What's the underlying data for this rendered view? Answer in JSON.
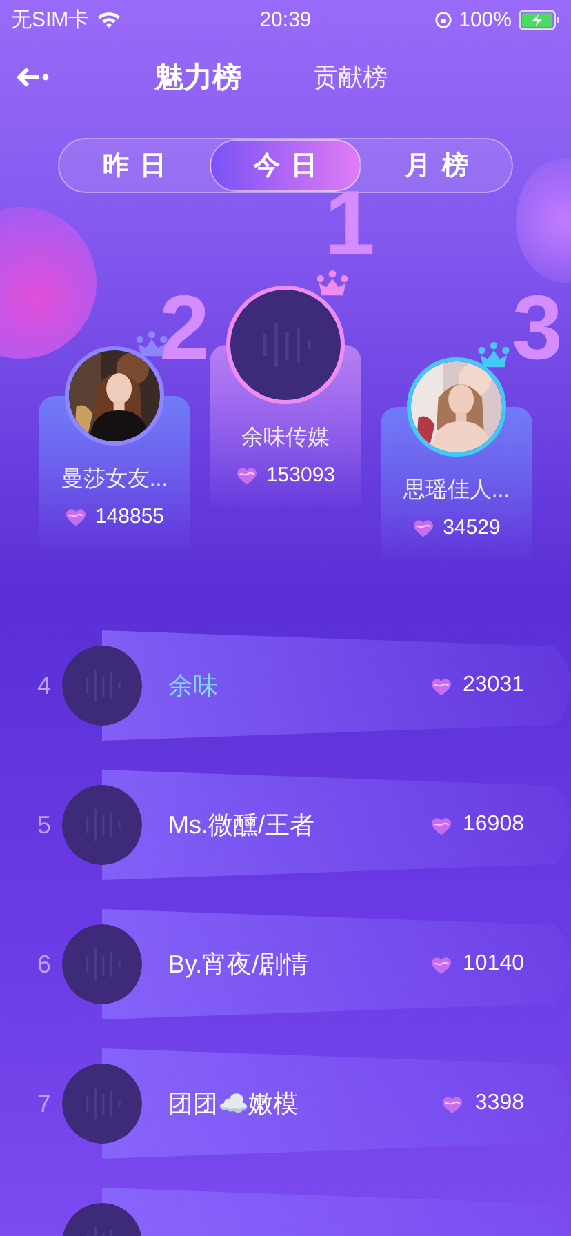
{
  "status_bar": {
    "carrier": "无SIM卡",
    "time": "20:39",
    "battery": "100%"
  },
  "nav_tabs": [
    {
      "label": "魅力榜",
      "selected": true
    },
    {
      "label": "贡献榜",
      "selected": false
    }
  ],
  "periods": [
    {
      "label": "昨日",
      "selected": false
    },
    {
      "label": "今日",
      "selected": true
    },
    {
      "label": "月榜",
      "selected": false
    }
  ],
  "podium": [
    {
      "rank": "2",
      "name": "曼莎女友...",
      "score": "148855",
      "color": "#8f86ff"
    },
    {
      "rank": "1",
      "name": "余味传媒",
      "score": "153093",
      "kind": "placeholder",
      "color": "#f08cf0"
    },
    {
      "rank": "3",
      "name": "思瑶佳人...",
      "score": "34529",
      "color": "#45c8f5"
    }
  ],
  "rows": [
    {
      "rank": "4",
      "name": "余味",
      "score": "23031",
      "kind": "placeholder",
      "color": "#7fd8f5"
    },
    {
      "rank": "5",
      "name": "Ms.微醺/王者",
      "score": "16908",
      "kind": "placeholder",
      "color": "#ffffff"
    },
    {
      "rank": "6",
      "name": "By.宵夜/剧情",
      "score": "10140",
      "kind": "placeholder",
      "color": "#ffffff"
    },
    {
      "rank": "7",
      "name": "团团☁️嫩模",
      "score": "3398",
      "kind": "placeholder",
      "color": "#ffffff"
    },
    {
      "kind": "placeholder"
    }
  ]
}
